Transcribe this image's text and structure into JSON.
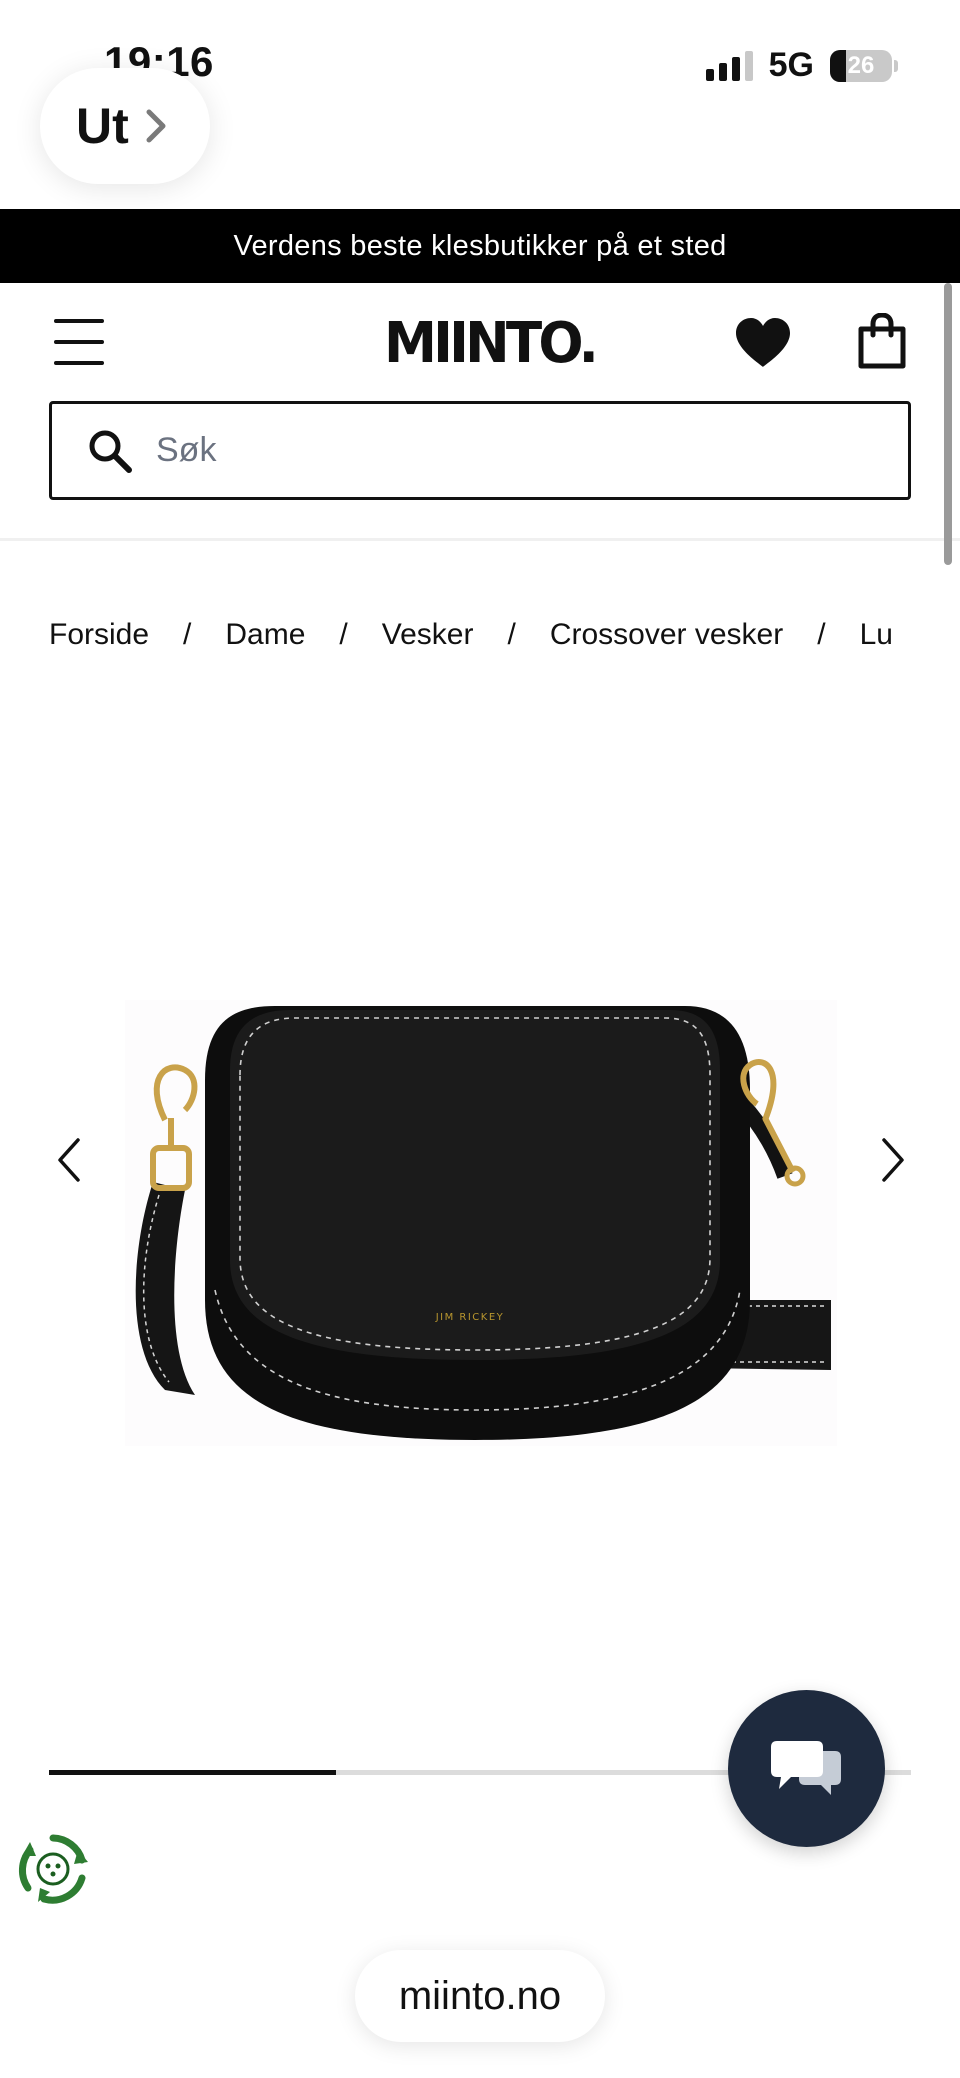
{
  "status_bar": {
    "time": "19:16",
    "network": "5G",
    "battery": "26"
  },
  "browser": {
    "back_label": "Ut",
    "url": "miinto.no"
  },
  "promo": {
    "text": "Verdens beste klesbutikker på et sted"
  },
  "header": {
    "logo": "MIINTO."
  },
  "search": {
    "placeholder": "Søk",
    "value": ""
  },
  "breadcrumb": {
    "separator": "/",
    "items": [
      "Forside",
      "Dame",
      "Vesker",
      "Crossover vesker",
      "Lu"
    ]
  },
  "product_image": {
    "brand_mark": "JIM RICKEY"
  },
  "gallery": {
    "progress": 0.333
  },
  "colors": {
    "promo_bg": "#000000",
    "chat_bg": "#1e2a3e",
    "eco_green": "#2e7d32"
  },
  "icons": [
    "chevron-right-icon",
    "menu-icon",
    "heart-icon",
    "bag-icon",
    "search-icon",
    "chevron-left-icon",
    "chat-icon",
    "recycle-icon"
  ]
}
